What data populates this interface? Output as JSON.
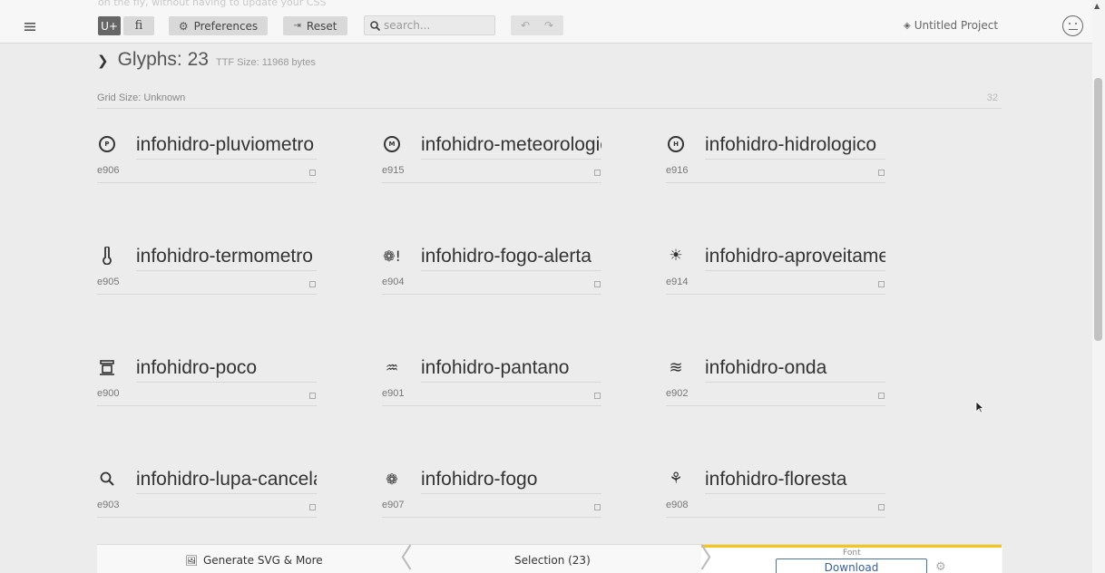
{
  "toolbar": {
    "faded_text": "on the fly, without having to update your CSS",
    "unicode_btn": "U+",
    "ligature_btn": "fi",
    "preferences": "Preferences",
    "reset": "Reset",
    "search_placeholder": "search...",
    "project": "Untitled Project"
  },
  "set": {
    "title": "Glyphs: 23",
    "subtitle": "TTF Size: 11968 bytes",
    "grid_size": "Grid Size: Unknown",
    "grid_value": "32"
  },
  "glyphs": [
    {
      "name": "infohidro-pluviometro",
      "code": "e906",
      "icon": "circle-p-icon"
    },
    {
      "name": "infohidro-meteorologico",
      "code": "e915",
      "icon": "circle-m-icon"
    },
    {
      "name": "infohidro-hidrologico",
      "code": "e916",
      "icon": "circle-h-icon"
    },
    {
      "name": "infohidro-termometro",
      "code": "e905",
      "icon": "thermometer-icon"
    },
    {
      "name": "infohidro-fogo-alerta",
      "code": "e904",
      "icon": "fire-alert-icon"
    },
    {
      "name": "infohidro-aproveitamento",
      "code": "e914",
      "icon": "sunrise-icon"
    },
    {
      "name": "infohidro-poco",
      "code": "e900",
      "icon": "well-icon"
    },
    {
      "name": "infohidro-pantano",
      "code": "e901",
      "icon": "swamp-icon"
    },
    {
      "name": "infohidro-onda",
      "code": "e902",
      "icon": "wave-icon"
    },
    {
      "name": "infohidro-lupa-cancelar",
      "code": "e903",
      "icon": "magnifier-icon"
    },
    {
      "name": "infohidro-fogo",
      "code": "e907",
      "icon": "fire-icon"
    },
    {
      "name": "infohidro-floresta",
      "code": "e908",
      "icon": "tree-icon"
    }
  ],
  "footer": {
    "generate": "Generate SVG & More",
    "selection": "Selection (23)",
    "font_label": "Font",
    "download": "Download"
  }
}
